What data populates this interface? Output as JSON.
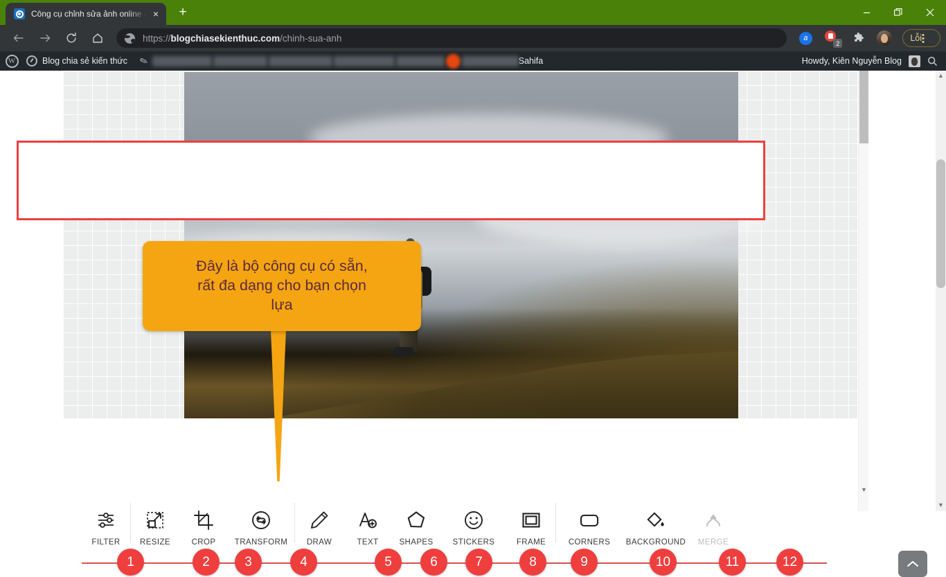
{
  "browser": {
    "tab": {
      "title": "Công cụ chỉnh sửa ảnh online - E",
      "favicon": "photo-editor-icon",
      "close": "×",
      "new_tab": "+"
    },
    "window_controls": {
      "minimize": "—",
      "restore": "❐",
      "close": "✕"
    },
    "nav": {
      "back": "←",
      "forward": "→",
      "reload": "⟳",
      "home": "⌂"
    },
    "omnibox": {
      "scheme": "https://",
      "domain": "blogchiasekienthuc.com",
      "path": "/chinh-sua-anh",
      "site_icon": "globe-icon"
    },
    "toolbar_right": {
      "adblock_label": "a",
      "notification_count": "2",
      "extensions_icon": "puzzle-icon",
      "profile_icon": "avatar",
      "profile_pill_label": "Lỗi",
      "menu_icon": "kebab-menu-icon"
    }
  },
  "wp_admin_bar": {
    "logo": "W",
    "site_name": "Blog chia sẻ kiến thức",
    "tail_item": "Sahifa",
    "howdy": "Howdy, Kiên Nguyễn Blog",
    "search_icon": "search-icon",
    "collapse_icon": "chevron-up-icon"
  },
  "callout": {
    "line1": "Đây là bộ công cụ có sẵn,",
    "line2": "rất đa dạng cho bạn chọn",
    "line3": "lựa",
    "bg_color": "#f5a511",
    "text_color": "#5c2b3e"
  },
  "editor": {
    "canvas_bg": "checkerboard",
    "photo_alt": "hiker-on-hillside-above-clouds",
    "toolbar": {
      "groups": [
        {
          "tools": [
            {
              "label": "FILTER",
              "icon": "sliders-icon",
              "badge": "1",
              "disabled": false
            }
          ]
        },
        {
          "tools": [
            {
              "label": "RESIZE",
              "icon": "resize-arrow-icon",
              "badge": "2",
              "disabled": false
            },
            {
              "label": "CROP",
              "icon": "crop-icon",
              "badge": "3",
              "disabled": false
            },
            {
              "label": "TRANSFORM",
              "icon": "rotate-refresh-icon",
              "badge": "4",
              "disabled": false
            }
          ]
        },
        {
          "tools": [
            {
              "label": "DRAW",
              "icon": "pencil-icon",
              "badge": "5",
              "disabled": false
            },
            {
              "label": "TEXT",
              "icon": "add-text-icon",
              "badge": "6",
              "disabled": false
            },
            {
              "label": "SHAPES",
              "icon": "pentagon-icon",
              "badge": "7",
              "disabled": false
            },
            {
              "label": "STICKERS",
              "icon": "smiley-icon",
              "badge": "8",
              "disabled": false
            },
            {
              "label": "FRAME",
              "icon": "frame-icon",
              "badge": "9",
              "disabled": false
            }
          ]
        },
        {
          "tools": [
            {
              "label": "CORNERS",
              "icon": "rounded-rect-icon",
              "badge": "10",
              "disabled": false
            },
            {
              "label": "BACKGROUND",
              "icon": "paint-drop-icon",
              "badge": "11",
              "disabled": false
            },
            {
              "label": "MERGE",
              "icon": "merge-arrow-icon",
              "badge": "12",
              "disabled": true
            }
          ]
        }
      ],
      "highlight_color": "#ef3e3e",
      "badge_color": "#ef3e3e"
    }
  },
  "back_to_top": {
    "icon": "chevron-up-icon",
    "label": ""
  },
  "scrollbars": {
    "inner_down_arrow": "▼",
    "main_up_arrow": "▲",
    "main_down_arrow": "▼"
  }
}
